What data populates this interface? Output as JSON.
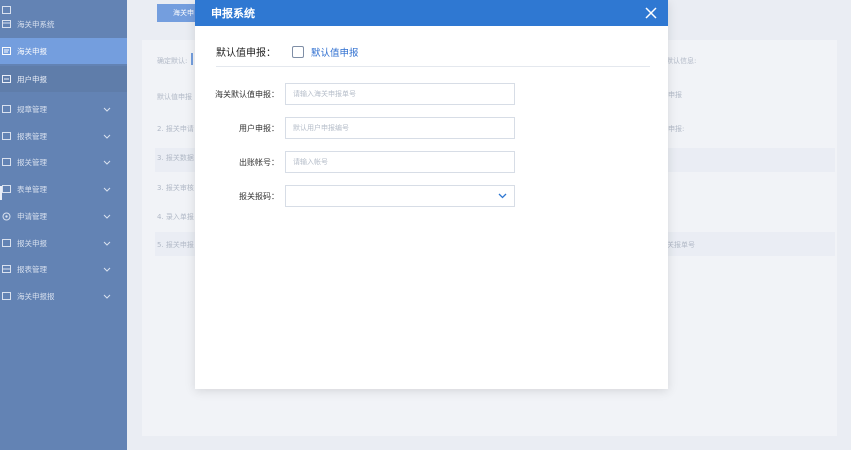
{
  "sidebar": {
    "items": [
      {
        "label": "海关申系统"
      },
      {
        "label": "海关申报"
      },
      {
        "label": "用户申报"
      },
      {
        "label": "规章管理"
      },
      {
        "label": "报表管理"
      },
      {
        "label": "报关管理"
      },
      {
        "label": "表单管理"
      },
      {
        "label": "申请管理"
      },
      {
        "label": "报关申报"
      },
      {
        "label": "报表管理"
      },
      {
        "label": "海关申报报"
      }
    ]
  },
  "background": {
    "tab_label": "海关申",
    "field_label": "确定默认:",
    "right_header": "默认信息:",
    "rows": [
      {
        "left": "默认值申报",
        "right": "申报"
      },
      {
        "left": "2. 报关申请",
        "right": "申报:"
      },
      {
        "left": "3. 报关数据",
        "right": ""
      },
      {
        "left": "3. 报关审核",
        "right": ""
      },
      {
        "left": "4. 录入单报",
        "right": ""
      },
      {
        "left": "5. 报关申报",
        "right": "报关报单号"
      }
    ]
  },
  "modal": {
    "title": "申报系统",
    "default_label": "默认值申报：",
    "default_checkbox_text": "默认值申报",
    "fields": [
      {
        "label": "海关默认值申报：",
        "placeholder": "请输入海关申报单号"
      },
      {
        "label": "用户申报：",
        "placeholder": "默认用户申报编号"
      },
      {
        "label": "出账帐号：",
        "placeholder": "请输入帐号"
      },
      {
        "label": "报关报码：",
        "value": ""
      }
    ]
  },
  "colors": {
    "accent": "#2f78d2",
    "sidebar": "#15468f"
  }
}
